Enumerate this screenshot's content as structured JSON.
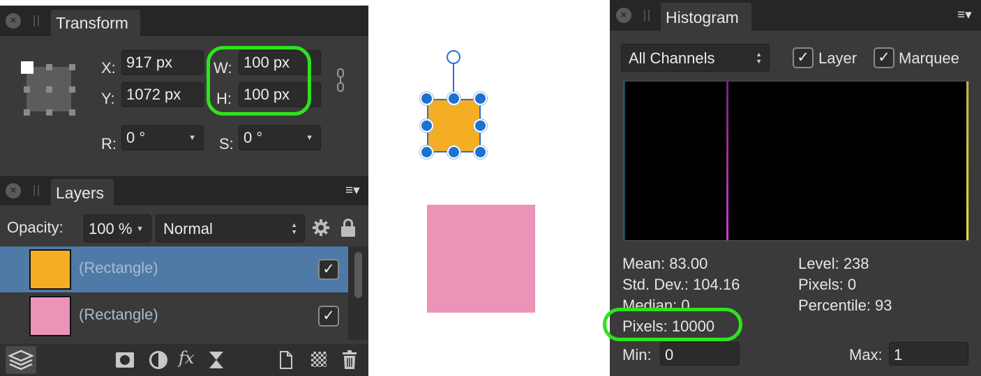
{
  "transform": {
    "tab": "Transform",
    "x_label": "X:",
    "x_value": "917 px",
    "y_label": "Y:",
    "y_value": "1072 px",
    "w_label": "W:",
    "w_value": "100 px",
    "h_label": "H:",
    "h_value": "100 px",
    "r_label": "R:",
    "r_value": "0 °",
    "s_label": "S:",
    "s_value": "0 °"
  },
  "layers": {
    "tab": "Layers",
    "opacity_label": "Opacity:",
    "opacity_value": "100 %",
    "blend_mode": "Normal",
    "items": [
      {
        "name": "(Rectangle)",
        "color": "#f5ae24",
        "selected": true,
        "visible": true
      },
      {
        "name": "(Rectangle)",
        "color": "#ec93b8",
        "selected": false,
        "visible": true
      }
    ]
  },
  "canvas": {
    "shape1_color": "#f5ae24",
    "shape2_color": "#ec93b8",
    "selection_color": "#1d72d0"
  },
  "histogram": {
    "tab": "Histogram",
    "channel": "All Channels",
    "layer_label": "Layer",
    "marquee_label": "Marquee",
    "layer_checked": true,
    "marquee_checked": true,
    "stats": {
      "mean": "Mean: 83.00",
      "std_dev": "Std. Dev.: 104.16",
      "median": "Median: 0",
      "pixels_total": "Pixels: 10000",
      "level": "Level: 238",
      "pixels_level": "Pixels: 0",
      "percentile": "Percentile: 93"
    },
    "min_label": "Min:",
    "min_value": "0",
    "max_label": "Max:",
    "max_value": "1"
  },
  "icons": {
    "close": "×",
    "check": "✓",
    "menu": "≡▾",
    "dropdown": "▼",
    "updown_up": "▲",
    "updown_down": "▼",
    "fx": "fx"
  }
}
